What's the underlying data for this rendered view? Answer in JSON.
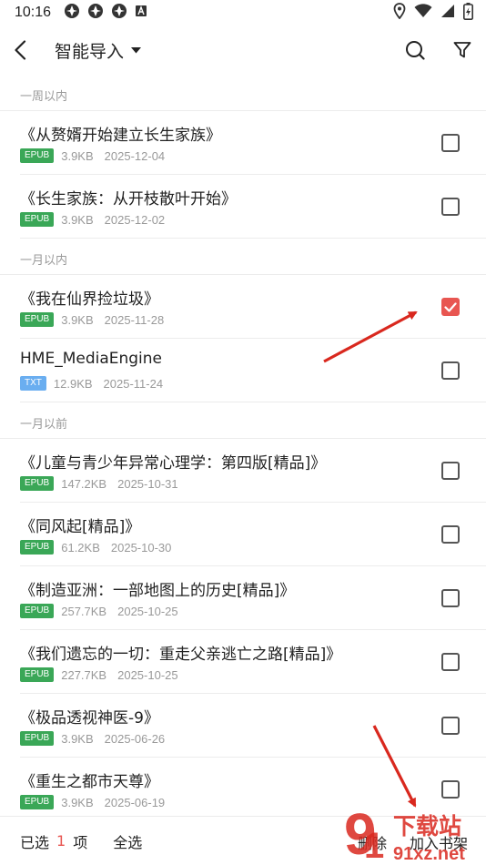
{
  "status_bar": {
    "time": "10:16"
  },
  "toolbar": {
    "title": "智能导入"
  },
  "sections": [
    {
      "header": "一周以内",
      "items": [
        {
          "name": "《从赘婿开始建立长生家族》",
          "format": "EPUB",
          "size": "3.9KB",
          "date": "2025-12-04",
          "checked": false
        },
        {
          "name": "《长生家族：从开枝散叶开始》",
          "format": "EPUB",
          "size": "3.9KB",
          "date": "2025-12-02",
          "checked": false
        }
      ]
    },
    {
      "header": "一月以内",
      "items": [
        {
          "name": "《我在仙界捡垃圾》",
          "format": "EPUB",
          "size": "3.9KB",
          "date": "2025-11-28",
          "checked": true
        },
        {
          "name": "HME_MediaEngine",
          "format": "TXT",
          "size": "12.9KB",
          "date": "2025-11-24",
          "checked": false
        }
      ]
    },
    {
      "header": "一月以前",
      "items": [
        {
          "name": "《儿童与青少年异常心理学：第四版[精品]》",
          "format": "EPUB",
          "size": "147.2KB",
          "date": "2025-10-31",
          "checked": false
        },
        {
          "name": "《同风起[精品]》",
          "format": "EPUB",
          "size": "61.2KB",
          "date": "2025-10-30",
          "checked": false
        },
        {
          "name": "《制造亚洲：一部地图上的历史[精品]》",
          "format": "EPUB",
          "size": "257.7KB",
          "date": "2025-10-25",
          "checked": false
        },
        {
          "name": "《我们遗忘的一切：重走父亲逃亡之路[精品]》",
          "format": "EPUB",
          "size": "227.7KB",
          "date": "2025-10-25",
          "checked": false
        },
        {
          "name": "《极品透视神医-9》",
          "format": "EPUB",
          "size": "3.9KB",
          "date": "2025-06-26",
          "checked": false
        },
        {
          "name": "《重生之都市天尊》",
          "format": "EPUB",
          "size": "3.9KB",
          "date": "2025-06-19",
          "checked": false
        }
      ]
    }
  ],
  "bottom_bar": {
    "selected_prefix": "已选",
    "selected_count": "1",
    "selected_suffix": "项",
    "select_all": "全选",
    "delete": "删除",
    "add": "加入书架"
  },
  "watermark": {
    "brand": "下载站",
    "site": "91xz.net"
  },
  "colors": {
    "accent": "#e85651",
    "epub": "#3aa757",
    "txt": "#6aaef0",
    "annotation_arrow": "#d9281e"
  }
}
